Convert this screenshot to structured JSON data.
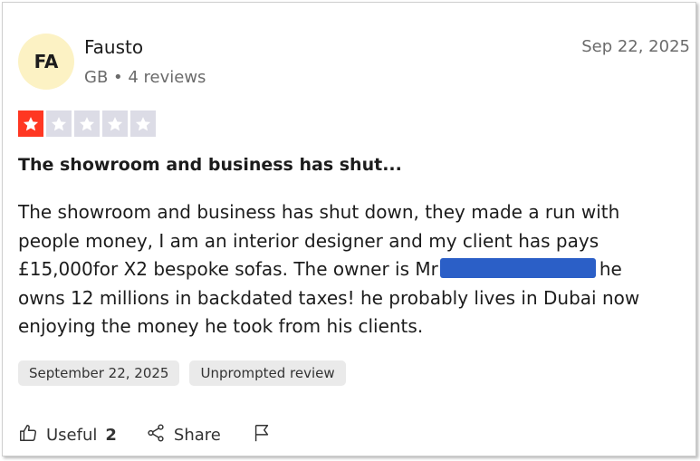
{
  "reviewer": {
    "initials": "FA",
    "name": "Fausto",
    "meta": "GB • 4 reviews"
  },
  "review": {
    "date": "Sep 22, 2025",
    "rating": 1,
    "rating_max": 5,
    "title": "The showroom and business has shut...",
    "body_before_redaction": "The showroom and business has shut down, they made a run with people money, I am an interior designer and my client has pays £15,000for X2 bespoke sofas. The owner is Mr",
    "body_after_redaction": "he owns 12 millions in backdated taxes! he probably lives in Dubai now enjoying the money he took from his clients."
  },
  "tags": [
    "September 22, 2025",
    "Unprompted review"
  ],
  "actions": {
    "useful_label": "Useful",
    "useful_count": "2",
    "share_label": "Share"
  },
  "colors": {
    "star_filled": "#ff3722",
    "star_empty": "#dcdce6",
    "avatar_bg": "#fcf2c4",
    "redaction": "#2b5fc7"
  },
  "icons": {
    "star": "star-icon",
    "useful": "thumbs-up-icon",
    "share": "share-icon",
    "report": "flag-icon"
  }
}
